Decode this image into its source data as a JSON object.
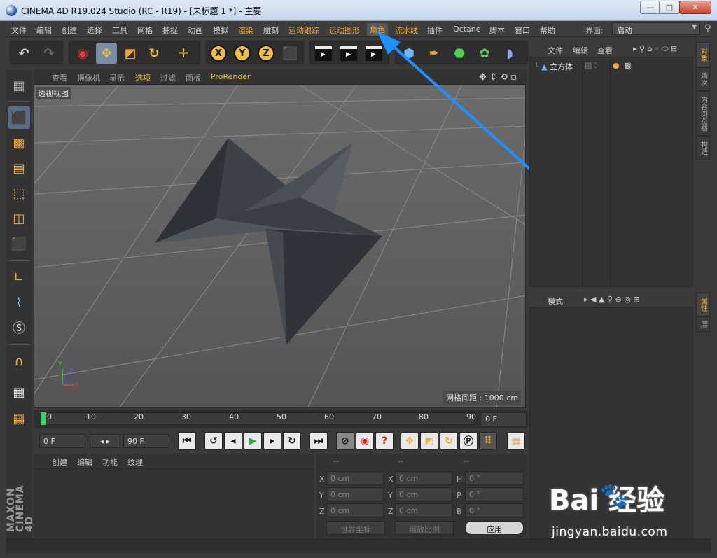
{
  "window": {
    "title": "CINEMA 4D R19.024 Studio (RC - R19) - [未标题 1 *] - 主要",
    "minimize": "—",
    "restore": "□",
    "close": "✕"
  },
  "menubar": {
    "items": [
      "文件",
      "编辑",
      "创建",
      "选择",
      "工具",
      "网格",
      "捕捉",
      "动画",
      "模拟",
      "渲染",
      "雕刻",
      "运动跟踪",
      "运动图形",
      "角色",
      "流水线",
      "插件",
      "Octane",
      "脚本",
      "窗口",
      "帮助"
    ],
    "layout_label": "界面:",
    "layout_value": "启动"
  },
  "viewport": {
    "menus": [
      "查看",
      "摄像机",
      "显示",
      "选项",
      "过滤",
      "面板",
      "ProRender"
    ],
    "label": "透视视图",
    "grid_spacing": "网格间距 : 1000 cm",
    "axes": [
      "Y",
      "Z",
      "X"
    ]
  },
  "timeline": {
    "ticks": [
      "0",
      "10",
      "20",
      "30",
      "40",
      "50",
      "60",
      "70",
      "80",
      "90"
    ],
    "frame_current": "0 F",
    "start_field": "0 F",
    "end_field": "90 F"
  },
  "material": {
    "menus": [
      "创建",
      "编辑",
      "功能",
      "纹理"
    ]
  },
  "coords": {
    "headers": [
      "--",
      "--",
      "--"
    ],
    "rows": [
      {
        "a": "X",
        "av": "0 cm",
        "b": "X",
        "bv": "0 cm",
        "c": "H",
        "cv": "0 °"
      },
      {
        "a": "Y",
        "av": "0 cm",
        "b": "Y",
        "bv": "0 cm",
        "c": "P",
        "cv": "0 °"
      },
      {
        "a": "Z",
        "av": "0 cm",
        "b": "Z",
        "bv": "0 cm",
        "c": "B",
        "cv": "0 °"
      }
    ],
    "world_coord": "世界坐标",
    "scale_mode": "缩放比例",
    "apply": "应用"
  },
  "objects": {
    "menus": [
      "文件",
      "编辑",
      "查看"
    ],
    "items": [
      "立方体"
    ]
  },
  "attributes": {
    "menus": [
      "模式"
    ]
  },
  "right_tabs_top": [
    "对象",
    "场次",
    "内容浏览器",
    "构造"
  ],
  "right_tabs_bottom": [
    "属性",
    "层"
  ],
  "logo": "MAXON CINEMA 4D",
  "watermark": {
    "brand": "Bai  经验",
    "url": "jingyan.baidu.com"
  },
  "colors": {
    "accent": "#f0a830",
    "arrow": "#1e90ff"
  }
}
